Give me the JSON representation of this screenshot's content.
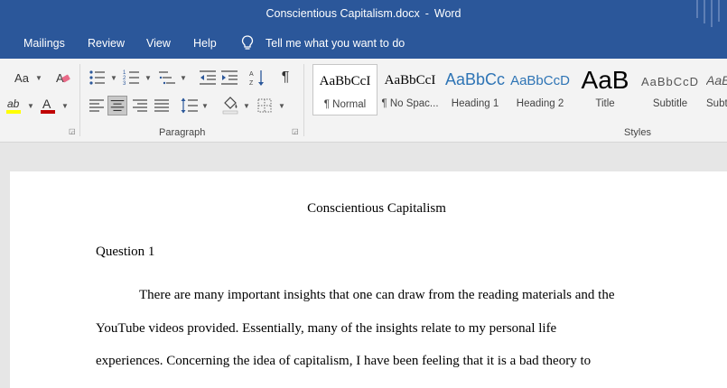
{
  "window": {
    "document_name": "Conscientious Capitalism.docx",
    "separator": "-",
    "app_name": "Word"
  },
  "tabs": [
    "Mailings",
    "Review",
    "View",
    "Help"
  ],
  "tell_me": {
    "label": "Tell me what you want to do",
    "icon": "lightbulb-icon"
  },
  "ribbon": {
    "groups": {
      "paragraph": "Paragraph",
      "styles": "Styles"
    },
    "font_size_label": "Aa",
    "pilcrow": "¶",
    "styles": [
      {
        "sample": "AaBbCcI",
        "name": "¶ Normal",
        "selected": true
      },
      {
        "sample": "AaBbCcI",
        "name": "¶ No Spac..."
      },
      {
        "sample": "AaBbCc",
        "name": "Heading 1"
      },
      {
        "sample": "AaBbCcD",
        "name": "Heading 2"
      },
      {
        "sample": "AaB",
        "name": "Title"
      },
      {
        "sample": "AaBbCcD",
        "name": "Subtitle"
      },
      {
        "sample": "AaB",
        "name": "Subt"
      }
    ],
    "colors": {
      "highlight": "#ffff00",
      "font_color": "#c00000",
      "accent": "#2b579a",
      "heading": "#2e74b5"
    }
  },
  "document": {
    "title": "Conscientious Capitalism",
    "question": "Question 1",
    "lines": [
      "There are many important insights that one can draw from the reading materials and the",
      "YouTube videos provided. Essentially, many of the insights relate to my personal life",
      "experiences. Concerning the idea of capitalism, I have been feeling that it is a bad theory to"
    ]
  }
}
